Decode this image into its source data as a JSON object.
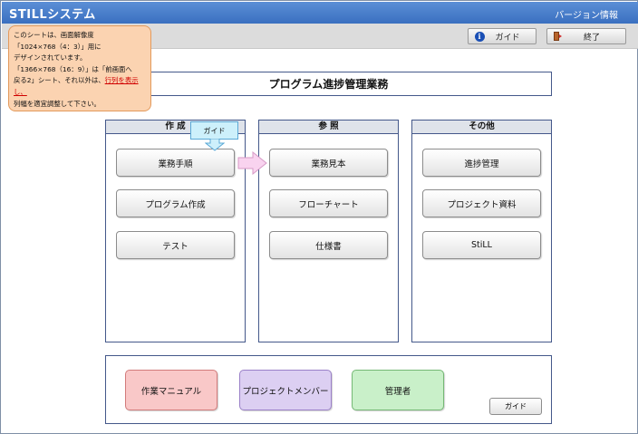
{
  "app": {
    "title": "STILLシステム",
    "version_link": "バージョン情報"
  },
  "toolbar": {
    "guide_label": "ガイド",
    "exit_label": "終了"
  },
  "note": {
    "line1": "このシートは、画面解像度",
    "line2": "「1024×768（4：3）」用に",
    "line3": "デザインされています。",
    "line4": "「1366×768（16：9）」は「前画面へ",
    "line5_a": "戻る2」シート、それ以外は、",
    "line5_b": "行列を表示し、",
    "line6": "列幅を適宜調整して下さい。"
  },
  "main_title": "プログラム進捗管理業務",
  "panels": [
    {
      "title": "作 成",
      "buttons": [
        "業務手順",
        "プログラム作成",
        "テスト"
      ]
    },
    {
      "title": "参 照",
      "buttons": [
        "業務見本",
        "フローチャート",
        "仕様書"
      ]
    },
    {
      "title": "その他",
      "buttons": [
        "進捗管理",
        "プロジェクト資料",
        "StiLL"
      ]
    }
  ],
  "guide_tag": "ガイド",
  "bottom": {
    "manual": "作業マニュアル",
    "members": "プロジェクトメンバー",
    "admin": "管理者",
    "guide": "ガイド"
  },
  "colors": {
    "titlebar": "#3a6fc0",
    "note_bg": "#fbd3b1",
    "manual_bg": "#f9c8c8",
    "members_bg": "#dccff2",
    "admin_bg": "#c9f0c9",
    "guide_tag_bg": "#cdf0fb",
    "arrow_fill": "#f9d3ef"
  }
}
